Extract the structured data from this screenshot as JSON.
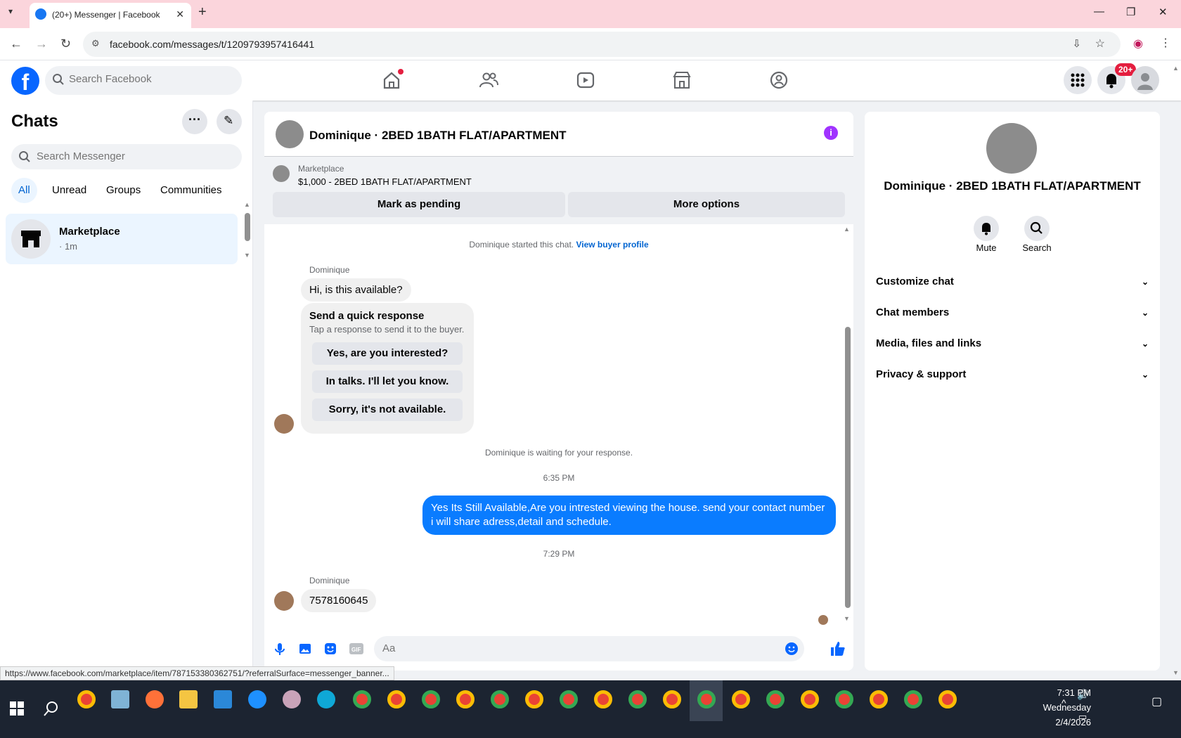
{
  "browser": {
    "tab_title": "(20+) Messenger | Facebook",
    "new_tab": "+",
    "url": "facebook.com/messages/t/1209793957416441",
    "status_url": "https://www.facebook.com/marketplace/item/787153380362751/?referralSurface=messenger_banner..."
  },
  "fb_header": {
    "search_placeholder": "Search Facebook",
    "notification_badge": "20+",
    "nav_icons": [
      "home-icon",
      "friends-icon",
      "video-icon",
      "marketplace-icon",
      "groups-icon"
    ]
  },
  "chats": {
    "title": "Chats",
    "search_placeholder": "Search Messenger",
    "filters": [
      "All",
      "Unread",
      "Groups",
      "Communities"
    ],
    "items": [
      {
        "name": "Marketplace",
        "subtitle": "· 1m"
      }
    ]
  },
  "conversation": {
    "title": "Dominique · 2BED 1BATH FLAT/APARTMENT",
    "marketplace_label": "Marketplace",
    "listing": "$1,000 - 2BED 1BATH FLAT/APARTMENT",
    "mark_pending": "Mark as pending",
    "more_options": "More options",
    "started_text": "Dominique started this chat.",
    "view_buyer_profile": "View buyer profile",
    "sender_name": "Dominique",
    "incoming_1": "Hi, is this available?",
    "quick_response_title": "Send a quick response",
    "quick_response_sub": "Tap a response to send it to the buyer.",
    "quick_responses": [
      "Yes, are you interested?",
      "In talks. I'll let you know.",
      "Sorry, it's not available."
    ],
    "waiting_text": "Dominique is waiting for your response.",
    "time_1": "6:35 PM",
    "outgoing_1": "Yes Its Still Available,Are you intrested viewing the house. send your contact number i will share adress,detail and schedule.",
    "time_2": "7:29 PM",
    "sender_name_2": "Dominique",
    "incoming_2": "7578160645",
    "composer_placeholder": "Aa"
  },
  "details": {
    "title": "Dominique · 2BED 1BATH FLAT/APARTMENT",
    "mute": "Mute",
    "search": "Search",
    "sections": [
      "Customize chat",
      "Chat members",
      "Media, files and links",
      "Privacy & support"
    ]
  },
  "taskbar": {
    "time": "7:31 PM",
    "day": "Wednesday",
    "date": "2/4/2026"
  },
  "colors": {
    "fb_blue": "#0866ff",
    "outgoing_bubble": "#0a7cff",
    "info_purple": "#a033ff",
    "badge_red": "#e41e3f"
  }
}
